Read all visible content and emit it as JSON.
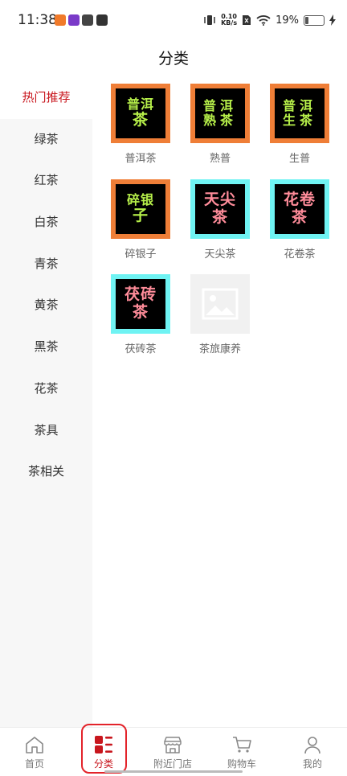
{
  "status": {
    "time": "11:38",
    "speed_value": "0.10",
    "speed_unit": "KB/s",
    "battery": "19%",
    "battery_level": 0.19
  },
  "header": {
    "title": "分类"
  },
  "sidebar": {
    "items": [
      {
        "label": "热门推荐",
        "active": true
      },
      {
        "label": "绿茶"
      },
      {
        "label": "红茶"
      },
      {
        "label": "白茶"
      },
      {
        "label": "青茶"
      },
      {
        "label": "黄茶"
      },
      {
        "label": "黑茶"
      },
      {
        "label": "花茶"
      },
      {
        "label": "茶具"
      },
      {
        "label": "茶相关"
      }
    ]
  },
  "grid": {
    "items": [
      {
        "label": "普洱茶",
        "art_line1": "普洱",
        "art_line2": "茶",
        "frame": "orange",
        "text_color": "green"
      },
      {
        "label": "熟普",
        "art_line1": "普洱",
        "art_line2": "熟茶",
        "frame": "orange",
        "text_color": "green"
      },
      {
        "label": "生普",
        "art_line1": "普洱",
        "art_line2": "生茶",
        "frame": "orange",
        "text_color": "green"
      },
      {
        "label": "碎银子",
        "art_line1": "碎银",
        "art_line2": "子",
        "frame": "orange",
        "text_color": "green"
      },
      {
        "label": "天尖茶",
        "art_line1": "天尖",
        "art_line2": "茶",
        "frame": "cyan",
        "text_color": "pink"
      },
      {
        "label": "花卷茶",
        "art_line1": "花卷",
        "art_line2": "茶",
        "frame": "cyan",
        "text_color": "pink"
      },
      {
        "label": "茯砖茶",
        "art_line1": "茯砖",
        "art_line2": "茶",
        "frame": "cyan",
        "text_color": "pink"
      },
      {
        "label": "茶旅康养",
        "placeholder": true
      }
    ]
  },
  "tabbar": {
    "items": [
      {
        "label": "首页",
        "icon": "home-icon"
      },
      {
        "label": "分类",
        "icon": "category-icon",
        "active": true
      },
      {
        "label": "附近门店",
        "icon": "store-icon"
      },
      {
        "label": "购物车",
        "icon": "cart-icon"
      },
      {
        "label": "我的",
        "icon": "user-icon"
      }
    ]
  },
  "colors": {
    "accent": "#c8161d",
    "frame_orange": "#ef7e37",
    "frame_cyan": "#6ff3f3",
    "art_green": "#b7f04a",
    "art_pink": "#ff8c9a"
  }
}
